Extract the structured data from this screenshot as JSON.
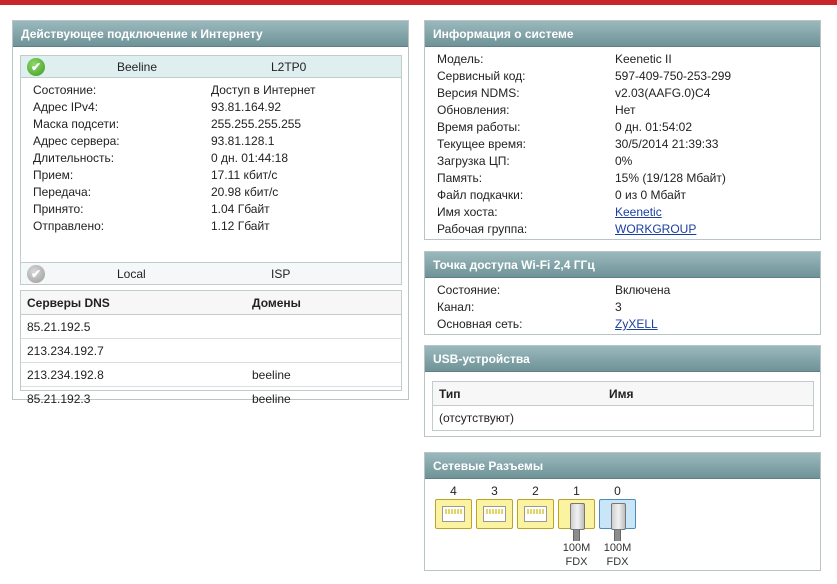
{
  "connection": {
    "title": "Действующее подключение к Интернету",
    "primary": {
      "name": "Beeline",
      "type": "L2TP0"
    },
    "rows": [
      {
        "label": "Состояние:",
        "value": "Доступ в Интернет"
      },
      {
        "label": "Адрес IPv4:",
        "value": "93.81.164.92"
      },
      {
        "label": "Маска подсети:",
        "value": "255.255.255.255"
      },
      {
        "label": "Адрес сервера:",
        "value": "93.81.128.1"
      },
      {
        "label": "Длительность:",
        "value": "0 дн. 01:44:18"
      },
      {
        "label": "Прием:",
        "value": "17.11 кбит/с"
      },
      {
        "label": "Передача:",
        "value": "20.98 кбит/с"
      },
      {
        "label": "Принято:",
        "value": "1.04 Гбайт"
      },
      {
        "label": "Отправлено:",
        "value": "1.12 Гбайт"
      }
    ],
    "secondary": {
      "name": "Local",
      "type": "ISP"
    }
  },
  "dns": {
    "col_servers": "Серверы DNS",
    "col_domains": "Домены",
    "rows": [
      {
        "server": "85.21.192.5",
        "domain": ""
      },
      {
        "server": "213.234.192.7",
        "domain": ""
      },
      {
        "server": "213.234.192.8",
        "domain": "beeline"
      },
      {
        "server": "85.21.192.3",
        "domain": "beeline"
      }
    ]
  },
  "system": {
    "title": "Информация о системе",
    "rows": [
      {
        "label": "Модель:",
        "value": "Keenetic II"
      },
      {
        "label": "Сервисный код:",
        "value": "597-409-750-253-299"
      },
      {
        "label": "Версия NDMS:",
        "value": "v2.03(AAFG.0)C4"
      },
      {
        "label": "Обновления:",
        "value": "Нет"
      },
      {
        "label": "Время работы:",
        "value": "0 дн. 01:54:02"
      },
      {
        "label": "Текущее время:",
        "value": "30/5/2014 21:39:33"
      },
      {
        "label": "Загрузка ЦП:",
        "value": "0%"
      },
      {
        "label": "Память:",
        "value": "15% (19/128 Мбайт)"
      },
      {
        "label": "Файл подкачки:",
        "value": "0 из 0 Мбайт"
      }
    ],
    "hostname_label": "Имя хоста:",
    "hostname": "Keenetic",
    "workgroup_label": "Рабочая группа:",
    "workgroup": "WORKGROUP"
  },
  "wifi": {
    "title": "Точка доступа Wi-Fi 2,4 ГГц",
    "state_label": "Состояние:",
    "state": "Включена",
    "channel_label": "Канал:",
    "channel": "3",
    "network_label": "Основная сеть:",
    "network": "ZyXELL"
  },
  "usb": {
    "title": "USB-устройства",
    "col_type": "Тип",
    "col_name": "Имя",
    "empty": "(отсутствуют)"
  },
  "ports": {
    "title": "Сетевые Разъемы",
    "items": [
      {
        "number": "4",
        "connected": false,
        "color": "#fbf3a0"
      },
      {
        "number": "3",
        "connected": false,
        "color": "#fbf3a0"
      },
      {
        "number": "2",
        "connected": false,
        "color": "#fbf3a0"
      },
      {
        "number": "1",
        "connected": true,
        "color": "#fbf3a0",
        "speed": "100M",
        "duplex": "FDX"
      },
      {
        "number": "0",
        "connected": true,
        "color": "#c8e6f7",
        "speed": "100M",
        "duplex": "FDX"
      }
    ]
  }
}
